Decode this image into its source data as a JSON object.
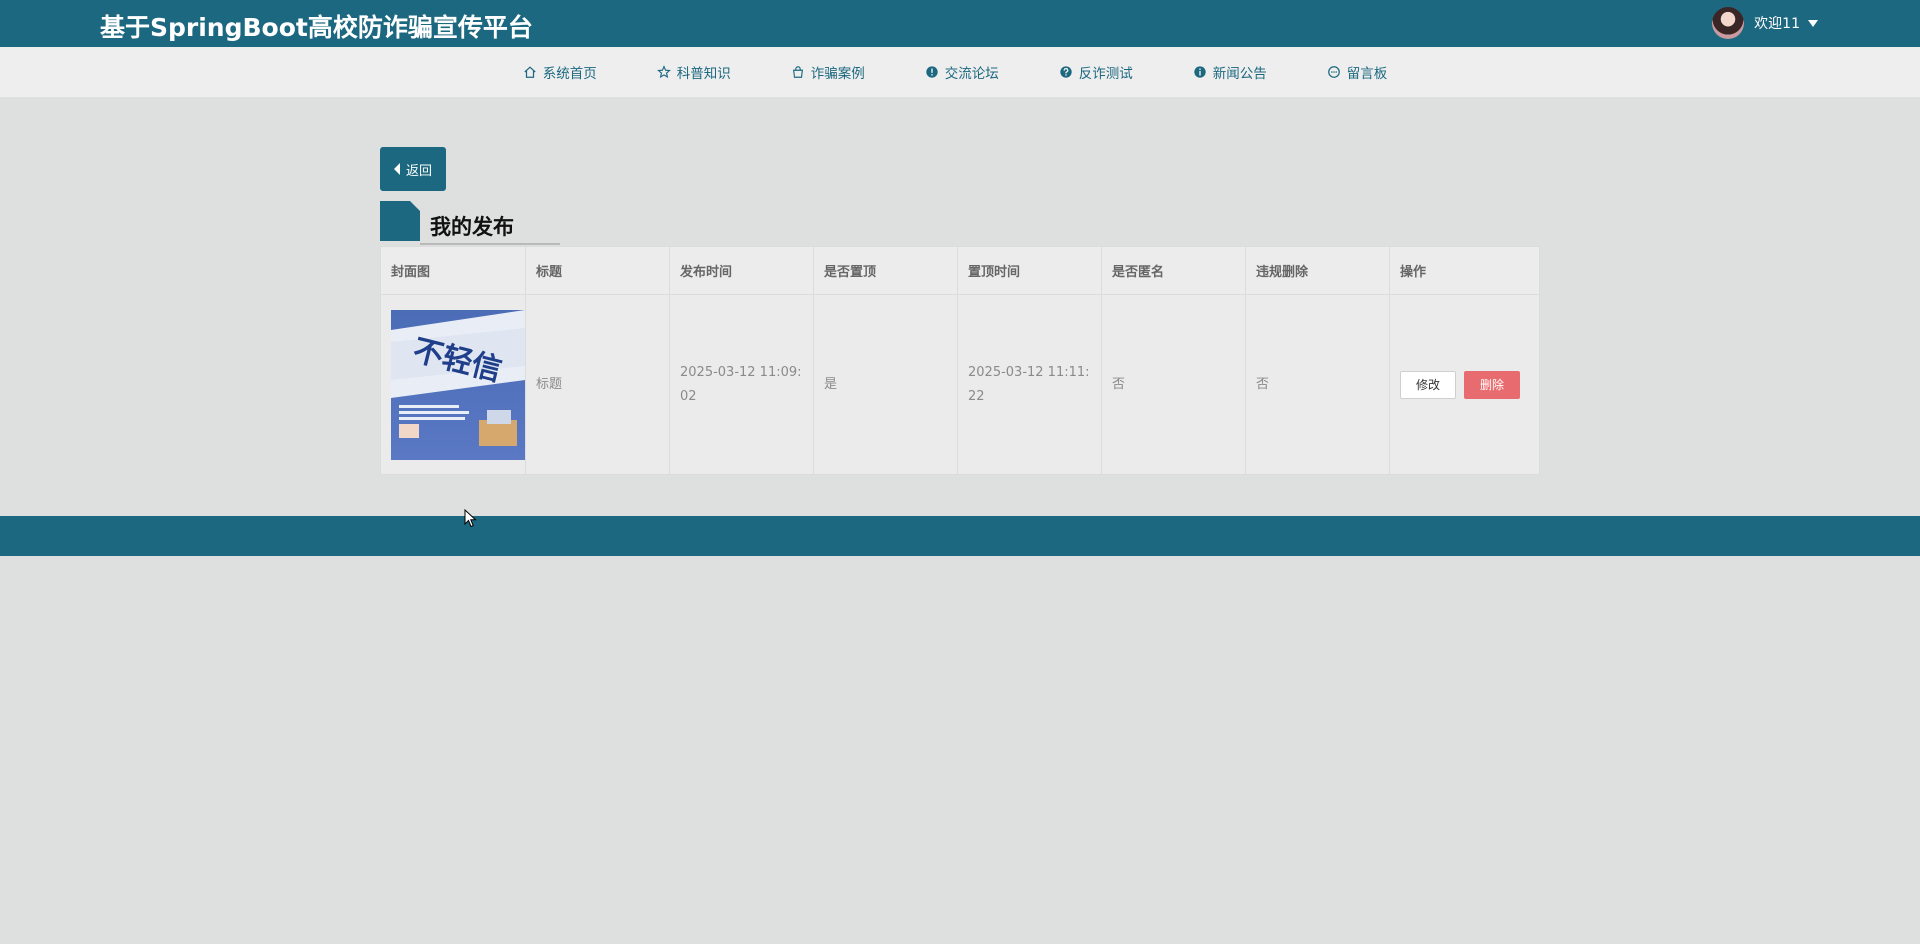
{
  "header": {
    "site_title": "基于SpringBoot高校防诈骗宣传平台",
    "user_greeting": "欢迎11"
  },
  "nav": {
    "items": [
      {
        "label": "系统首页",
        "icon": "home-icon"
      },
      {
        "label": "科普知识",
        "icon": "star-icon"
      },
      {
        "label": "诈骗案例",
        "icon": "bag-icon"
      },
      {
        "label": "交流论坛",
        "icon": "alert-circle-icon"
      },
      {
        "label": "反诈测试",
        "icon": "question-circle-icon"
      },
      {
        "label": "新闻公告",
        "icon": "info-circle-icon"
      },
      {
        "label": "留言板",
        "icon": "message-circle-icon"
      }
    ]
  },
  "back_button": {
    "label": "返回"
  },
  "section": {
    "title": "我的发布"
  },
  "table": {
    "headers": [
      "封面图",
      "标题",
      "发布时间",
      "是否置顶",
      "置顶时间",
      "是否匿名",
      "违规删除",
      "操作"
    ],
    "rows": [
      {
        "cover_text": "不轻信",
        "title": "标题",
        "publish_time": "2025-03-12 11:09:02",
        "is_top": "是",
        "top_time": "2025-03-12 11:11:22",
        "is_anonymous": "否",
        "violation_deleted": "否",
        "edit_label": "修改",
        "delete_label": "删除"
      }
    ]
  },
  "colors": {
    "primary": "#1c6880",
    "danger": "#e86b6f",
    "background": "#dedfdf",
    "nav_background": "#eeeeee"
  }
}
